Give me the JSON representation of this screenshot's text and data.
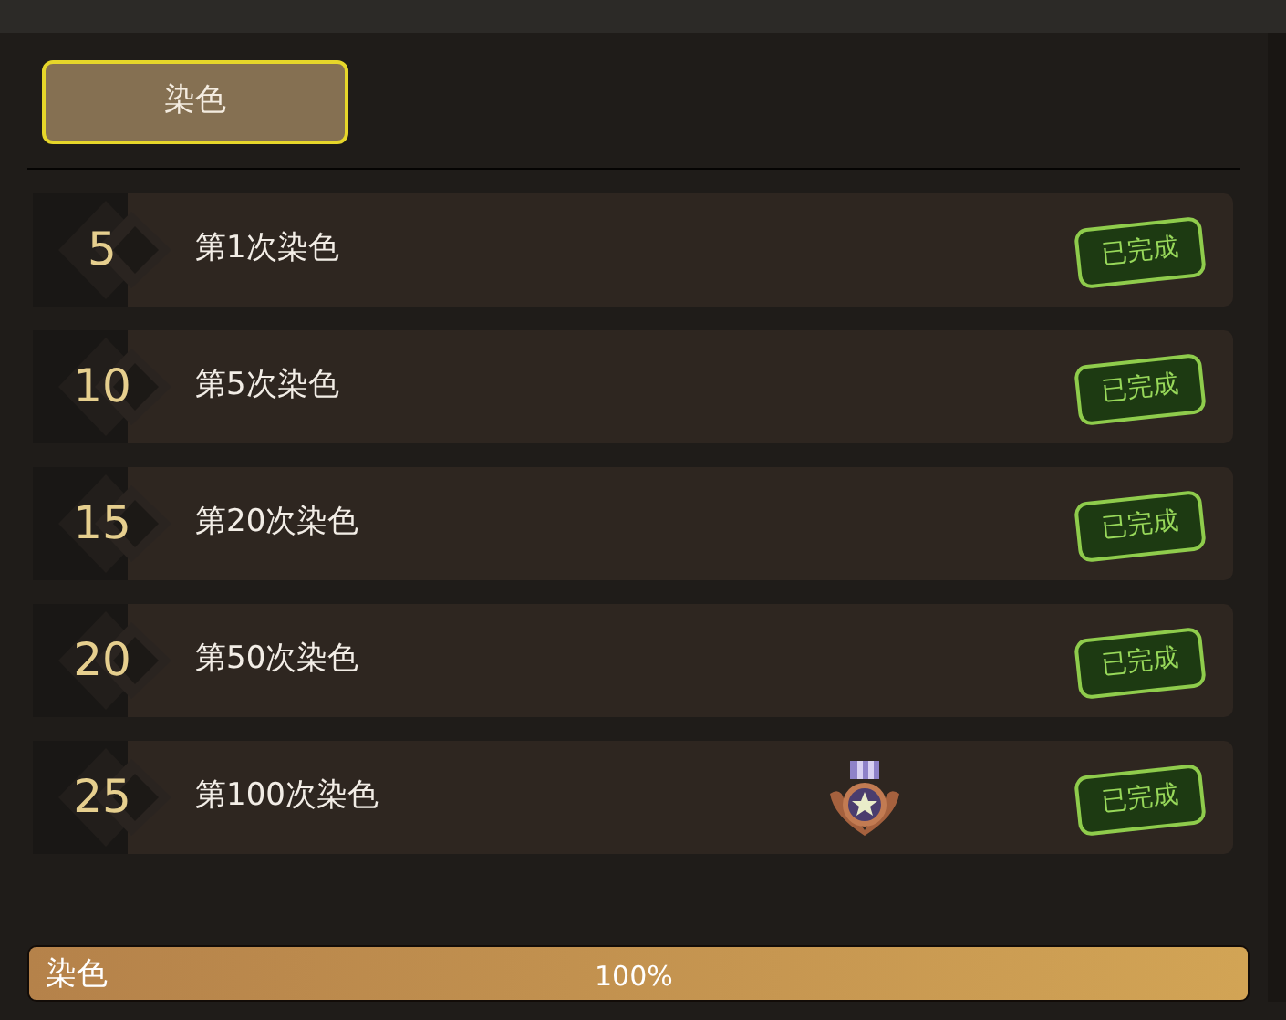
{
  "tabs": [
    {
      "label": "染色",
      "selected": true
    }
  ],
  "achievements": [
    {
      "points": "5",
      "title": "第1次染色",
      "status": "已完成",
      "reward": false
    },
    {
      "points": "10",
      "title": "第5次染色",
      "status": "已完成",
      "reward": false
    },
    {
      "points": "15",
      "title": "第20次染色",
      "status": "已完成",
      "reward": false
    },
    {
      "points": "20",
      "title": "第50次染色",
      "status": "已完成",
      "reward": false
    },
    {
      "points": "25",
      "title": "第100次染色",
      "status": "已完成",
      "reward": true
    }
  ],
  "progress": {
    "label": "染色",
    "reading": "100%",
    "level": 1
  }
}
